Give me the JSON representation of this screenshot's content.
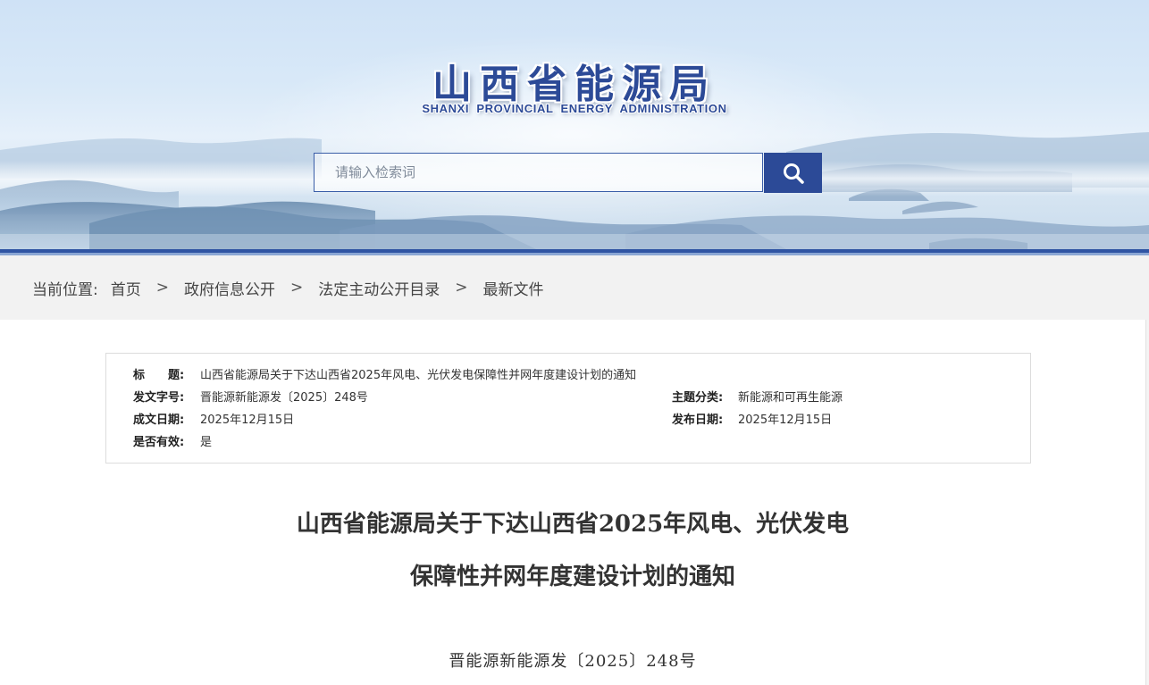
{
  "header": {
    "logo_cn": "山西省能源局",
    "logo_en": "SHANXI PROVINCIAL ENERGY ADMINISTRATION",
    "search_placeholder": "请输入检索词",
    "search_icon": "search-icon",
    "brand_color": "#2c4a97"
  },
  "breadcrumb": {
    "label": "当前位置:",
    "items": [
      "首页",
      "政府信息公开",
      "法定主动公开目录",
      "最新文件"
    ],
    "separator": ">"
  },
  "meta": {
    "title_label": "标　　题:",
    "title_value": "山西省能源局关于下达山西省2025年风电、光伏发电保障性并网年度建设计划的通知",
    "doc_no_label": "发文字号:",
    "doc_no_value": "晋能源新能源发〔2025〕248号",
    "topic_label": "主题分类:",
    "topic_value": "新能源和可再生能源",
    "written_label": "成文日期:",
    "written_value": "2025年12月15日",
    "publish_label": "发布日期:",
    "publish_value": "2025年12月15日",
    "valid_label": "是否有效:",
    "valid_value": "是"
  },
  "document": {
    "title_line1": "山西省能源局关于下达山西省2025年风电、光伏发电",
    "title_line2": "保障性并网年度建设计划的通知",
    "number": "晋能源新能源发〔2025〕248号"
  }
}
